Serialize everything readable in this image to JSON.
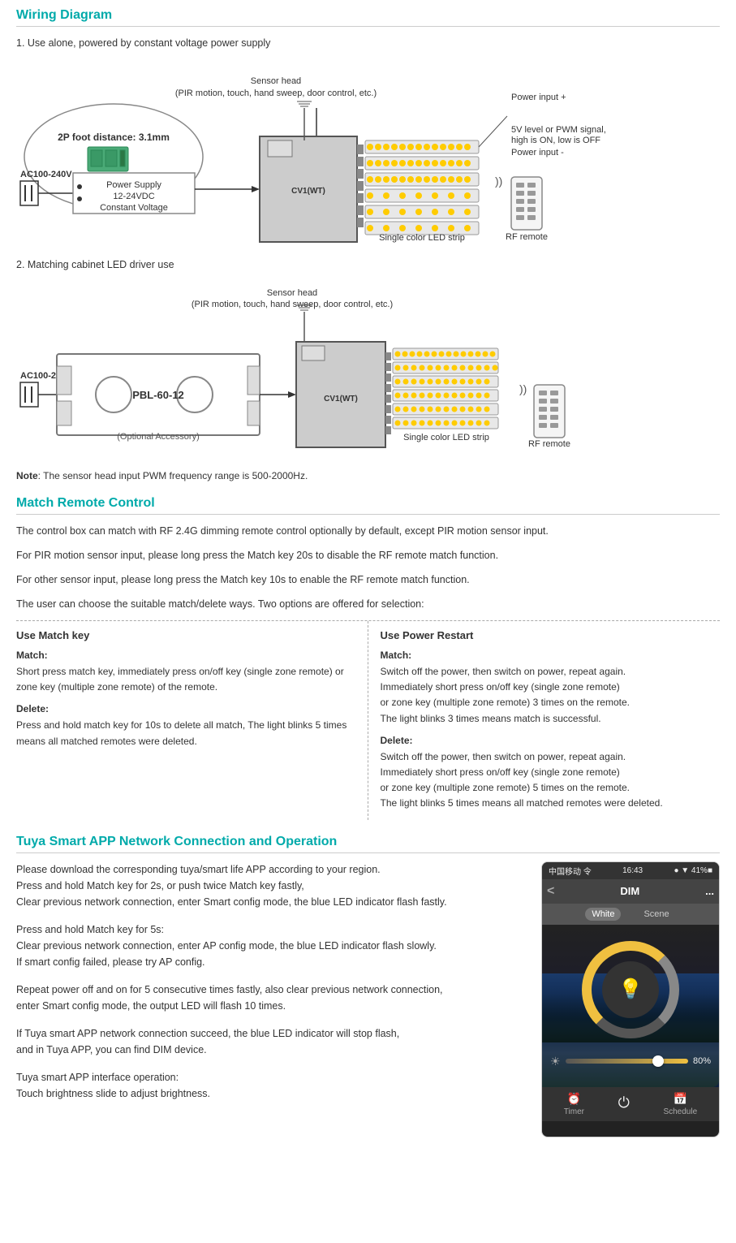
{
  "sections": {
    "wiring_diagram": {
      "title": "Wiring Diagram",
      "subsection1_label": "1. Use alone, powered by constant voltage power supply",
      "subsection2_label": "2. Matching cabinet LED driver use",
      "foot_distance_label": "2P foot distance: 3.1mm",
      "sensor_head_label": "Sensor head",
      "sensor_head_sub": "(PIR motion, touch, hand sweep, door control, etc.)",
      "power_input_plus": "Power input +",
      "pwm_signal": "5V level or PWM signal,",
      "pwm_signal2": "high is ON, low is OFF",
      "power_input_minus": "Power input -",
      "ac_voltage": "AC100-240V",
      "power_supply_line1": "Power Supply",
      "power_supply_line2": "12-24VDC",
      "power_supply_line3": "Constant Voltage",
      "controller_label": "CV1(WT)",
      "single_color_led": "Single color LED strip",
      "rf_remote_label": "RF remote",
      "pbl_label": "PBL-60-12",
      "optional_accessory": "(Optional Accessory)",
      "note": "Note",
      "note_text": ": The sensor head input PWM frequency range is 500-2000Hz."
    },
    "match_remote": {
      "title": "Match Remote Control",
      "description_lines": [
        "The control box can match with RF 2.4G dimming remote control optionally by default, except PIR motion sensor input.",
        "For PIR motion sensor input, please long press the Match key 20s to disable the RF remote match function.",
        "For other sensor input, please long press the Match key 10s to enable the RF remote match function.",
        "The user can choose the suitable match/delete ways. Two options are offered for selection:"
      ],
      "col_left": {
        "heading": "Use Match key",
        "match_heading": "Match:",
        "match_text": "Short press match key, immediately press on/off key (single zone remote) or zone key (multiple zone  remote) of the remote.",
        "delete_heading": "Delete:",
        "delete_text": "Press and hold match key for 10s to delete all match,\nThe light blinks 5 times means all matched remotes were deleted."
      },
      "col_right": {
        "heading": "Use Power Restart",
        "match_heading": "Match:",
        "match_text": "Switch off the power, then switch on power, repeat again.\nImmediately short press on/off key (single zone remote)\nor zone key (multiple zone remote) 3 times on the remote.\nThe light blinks 3 times means match is successful.",
        "delete_heading": "Delete:",
        "delete_text": "Switch off the power, then switch on power, repeat again.\nImmediately short press on/off key (single zone remote)\nor zone key (multiple zone remote) 5 times on the remote.\nThe light blinks 5 times means all matched remotes were deleted."
      }
    },
    "tuya": {
      "title": "Tuya Smart APP Network Connection and Operation",
      "paragraphs": [
        "Please download the corresponding tuya/smart life APP according to your region.\nPress and hold Match key for 2s, or push twice Match key fastly,\nClear previous network connection, enter Smart config mode, the blue LED indicator flash fastly.",
        "Press and hold Match key for 5s:\nClear previous network connection, enter AP config mode, the blue LED indicator flash slowly.\nIf smart config failed, please try AP config.",
        "Repeat power off and on for 5 consecutive times fastly, also clear previous network connection,\nenter Smart config mode, the output LED will flash 10 times.",
        "If Tuya smart APP network connection succeed, the blue LED indicator will stop flash,\nand in Tuya APP, you can find DIM device.",
        "Tuya smart APP interface operation:\nTouch brightness slide to adjust brightness."
      ],
      "app": {
        "status_bar": {
          "left": "中国移动 令",
          "time": "16:43",
          "right": "● ▼ 41%■"
        },
        "header_title": "DIM",
        "back_label": "<",
        "more_label": "...",
        "tabs": [
          "White",
          "Scene"
        ],
        "active_tab": "White",
        "slider_percent": "80%",
        "bottom_items": [
          "Timer",
          "⏻",
          "Schedule"
        ]
      }
    }
  }
}
